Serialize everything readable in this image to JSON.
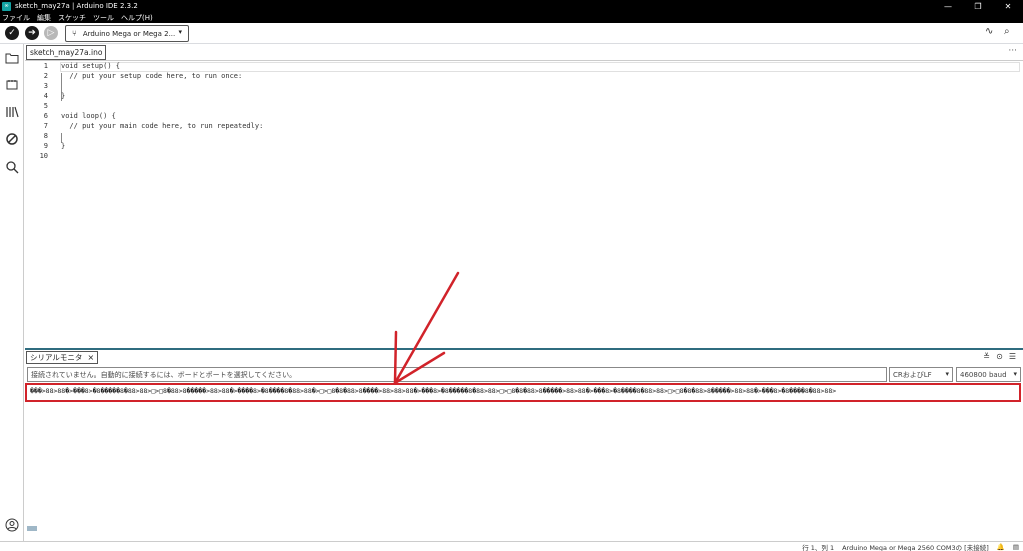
{
  "window": {
    "title": "sketch_may27a | Arduino IDE 2.3.2",
    "logo_text": "∞",
    "controls": [
      "—",
      "❐",
      "✕"
    ]
  },
  "menu": {
    "items": [
      "ファイル",
      "編集",
      "スケッチ",
      "ツール",
      "ヘルプ(H)"
    ]
  },
  "toolbar": {
    "verify_icon": "✓",
    "upload_icon": "➔",
    "debug_icon": "▷",
    "board_usb_icon": "⑂",
    "board_label": "Arduino Mega or Mega 2...",
    "board_caret": "▾",
    "plotter_icon": "∿",
    "monitor_icon": "⌕"
  },
  "sidebar": {
    "icons": [
      "folder-icon",
      "board-icon",
      "library-icon",
      "debug-off-icon",
      "search-icon"
    ],
    "account_icon": "account-icon"
  },
  "editor": {
    "tab_label": "sketch_may27a.ino",
    "more_label": "···",
    "lines": [
      {
        "num": "1",
        "code": "void setup() {"
      },
      {
        "num": "2",
        "code": "  // put your setup code here, to run once:"
      },
      {
        "num": "3",
        "code": ""
      },
      {
        "num": "4",
        "code": "}"
      },
      {
        "num": "5",
        "code": ""
      },
      {
        "num": "6",
        "code": "void loop() {"
      },
      {
        "num": "7",
        "code": "  // put your main code here, to run repeatedly:"
      },
      {
        "num": "8",
        "code": ""
      },
      {
        "num": "9",
        "code": "}"
      },
      {
        "num": "10",
        "code": ""
      }
    ]
  },
  "serial": {
    "tab_label": "シリアルモニタ",
    "tab_close": "×",
    "ctrls": [
      "≚",
      "⊙",
      "☰"
    ],
    "input_placeholder": "接続されていません。自動的に接続するには、ボードとポートを選択してください。",
    "line_ending": "CRおよびLF",
    "baud": "460800 baud",
    "caret": "▾",
    "output": "���>88>88�>���8>�8�����8�88>88>□>□8�88>8�����>88>88�>����8>�8����8�88>88�>□>□8�8�88>8����>88>88>88�>���8>�8�����8�88>88>□>□8�8�88>8�����>88>88�>���8>�8����8�88>88>□>□8�8�88>8�����>88>88�>���8>�8����8�88>88>"
  },
  "status": {
    "position": "行 1、列 1",
    "board": "Arduino Mega or Mega 2560 COM3の [未接続]",
    "bell_icon": "🔔",
    "layout_icon": "▤"
  },
  "annotation": {
    "color": "#d1232a"
  }
}
